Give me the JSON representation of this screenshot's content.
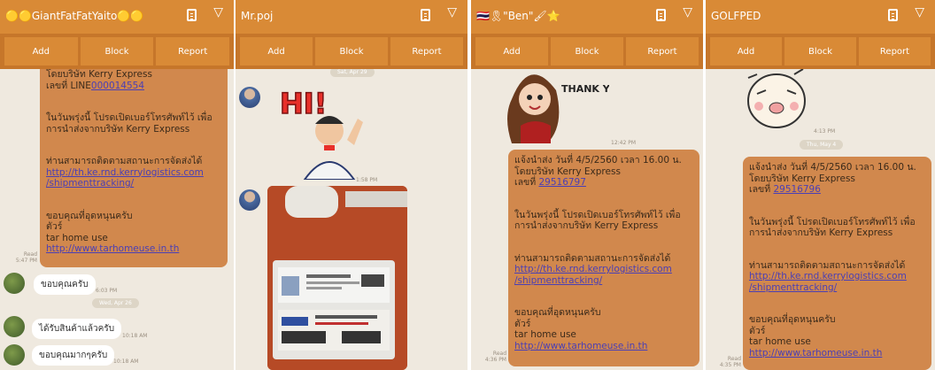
{
  "action_labels": {
    "add": "Add",
    "block": "Block",
    "report": "Report"
  },
  "panels": [
    {
      "title": "🟡🟡GiantFatFatYaito🟡🟡",
      "message": {
        "lines": [
          "โดยบริษัท Kerry Express",
          "เลขที่ LINE"
        ],
        "tracking": "000014554",
        "para2": [
          "ในวันพรุ่งนี้ โปรดเปิดเบอร์โทรศัพท์ไว้ เพื่อ",
          "การนำส่งจากบริษัท Kerry Express"
        ],
        "para3": "ท่านสามารถติดตามสถานะการจัดส่งได้",
        "link1a": "http://th.ke.rnd.kerrylogistics.com",
        "link1b": "/shipmenttracking/",
        "thanks": [
          "ขอบคุณที่อุดหนุนครับ",
          "ตัวร์",
          "tar home use"
        ],
        "link2": "http://www.tarhomeuse.in.th",
        "read": "Read",
        "time": "5:47 PM"
      },
      "replies": [
        {
          "text": "ขอบคุณครับ",
          "time": "6:03 PM"
        },
        {
          "text": "ได้รับสินค้าแล้วครับ",
          "time": "10:18 AM"
        },
        {
          "text": "ขอบคุณมากๆครับ",
          "time": "10:18 AM"
        }
      ],
      "date": "Wed, Apr 26"
    },
    {
      "title": "Mr.poj",
      "date_partial": "Sat, Apr 29",
      "sticker_text": "HI!",
      "photo_time": "1:58 PM"
    },
    {
      "title": "🇹🇭🎗\"Ben\"🖌⭐",
      "sticker_text": "THANK YOU",
      "sticker_time": "12:42 PM",
      "message": {
        "line1": "แจ้งนำส่ง วันที่    4/5/2560 เวลา 16.00 น.",
        "line2": "โดยบริษัท Kerry Express",
        "line3": "เลขที่ ",
        "tracking": "29516797",
        "read": "Read",
        "time": "4:36 PM"
      }
    },
    {
      "title": "GOLFPED",
      "sticker_time": "4:13 PM",
      "date": "Thu, May 4",
      "message": {
        "line1": "แจ้งนำส่ง วันที่    4/5/2560 เวลา 16.00 น.",
        "line2": "โดยบริษัท Kerry Express",
        "line3": "เลขที่ ",
        "tracking": "29516796",
        "read": "Read",
        "time": "4:35 PM"
      }
    }
  ]
}
